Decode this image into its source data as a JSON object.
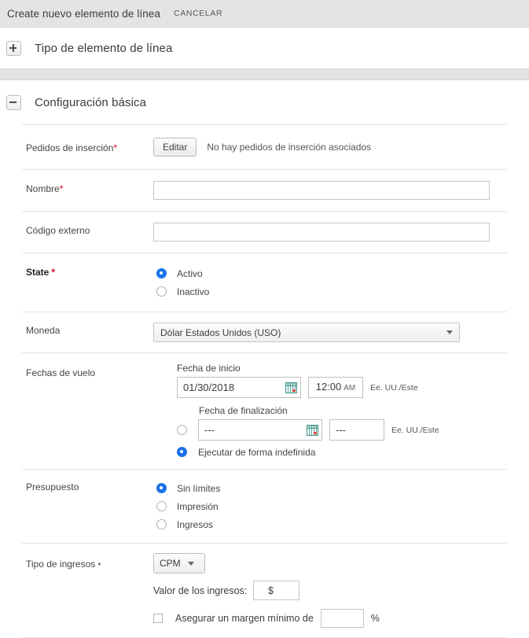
{
  "topbar": {
    "title": "Create nuevo elemento de línea",
    "cancel_label": "CANCELAR"
  },
  "sections": [
    {
      "toggle_icon": "plus-icon",
      "title": "Tipo de elemento de línea",
      "expanded": false
    },
    {
      "toggle_icon": "minus-icon",
      "title": "Configuración básica",
      "expanded": true
    }
  ],
  "form": {
    "insertion_orders": {
      "label": "Pedidos de inserción",
      "required_mark": "*",
      "edit_button": "Editar",
      "status_text": "No hay pedidos de inserción asociados"
    },
    "name": {
      "label": "Nombre",
      "required_mark": "*",
      "value": "",
      "placeholder": ""
    },
    "external_code": {
      "label": "Código externo",
      "value": "",
      "placeholder": ""
    },
    "state": {
      "label": "State",
      "required_mark": "*",
      "options": [
        {
          "label": "Activo",
          "selected": true
        },
        {
          "label": "Inactivo",
          "selected": false
        }
      ]
    },
    "currency": {
      "label": "Moneda",
      "selected": "Dólar Estados Unidos (USO)",
      "caret_icon": "chevron-down-icon"
    },
    "flight_dates": {
      "label": "Fechas de vuelo",
      "start": {
        "sub_label": "Fecha de inicio",
        "date_value": "01/30/2018",
        "calendar_icon": "calendar-icon",
        "time_value": "12:00",
        "time_meridiem": "AM",
        "timezone": "Ee. UU./Este"
      },
      "end": {
        "sub_label": "Fecha de finalización",
        "selected": false,
        "date_value": "---",
        "calendar_icon": "calendar-icon",
        "time_value": "---",
        "timezone": "Ee. UU./Este"
      },
      "run_indefinitely": {
        "label": "Ejecutar de forma indefinida",
        "selected": true
      }
    },
    "budget": {
      "label": "Presupuesto",
      "options": [
        {
          "label": "Sin límites",
          "selected": true
        },
        {
          "label": "Impresión",
          "selected": false
        },
        {
          "label": "Ingresos",
          "selected": false
        }
      ]
    },
    "revenue_type": {
      "label": "Tipo de ingresos",
      "required_mark": "•",
      "selected": "CPM",
      "caret_icon": "chevron-down-icon",
      "value_label": "Valor de los ingresos:",
      "currency_symbol": "$",
      "value_amount": "",
      "margin": {
        "checked": false,
        "label": "Asegurar un margen mínimo de",
        "value": "",
        "unit": "%"
      }
    }
  },
  "colors": {
    "accent_blue": "#1a73e8",
    "required_red": "#d0021b",
    "topbar_gray": "#e4e4e4",
    "band_gray": "#e2e2e2"
  }
}
